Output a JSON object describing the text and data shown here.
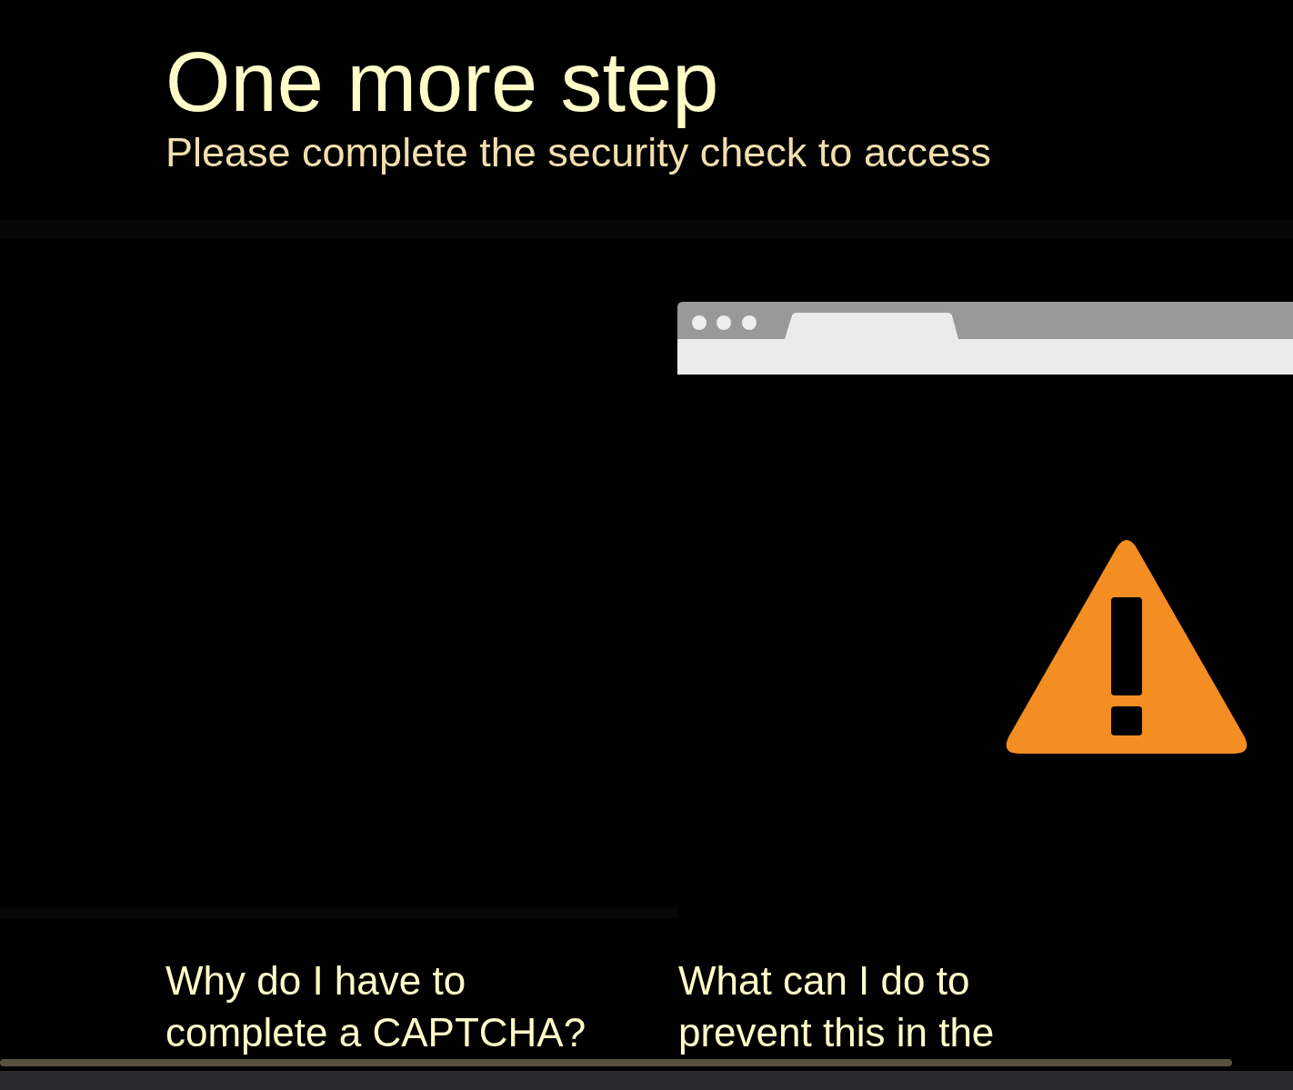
{
  "title": "One more step",
  "subtitle": "Please complete the security check to access",
  "questions": [
    {
      "text": "Why do I have to complete a CAPTCHA?"
    },
    {
      "text": "What can I do to prevent this in the"
    }
  ]
}
